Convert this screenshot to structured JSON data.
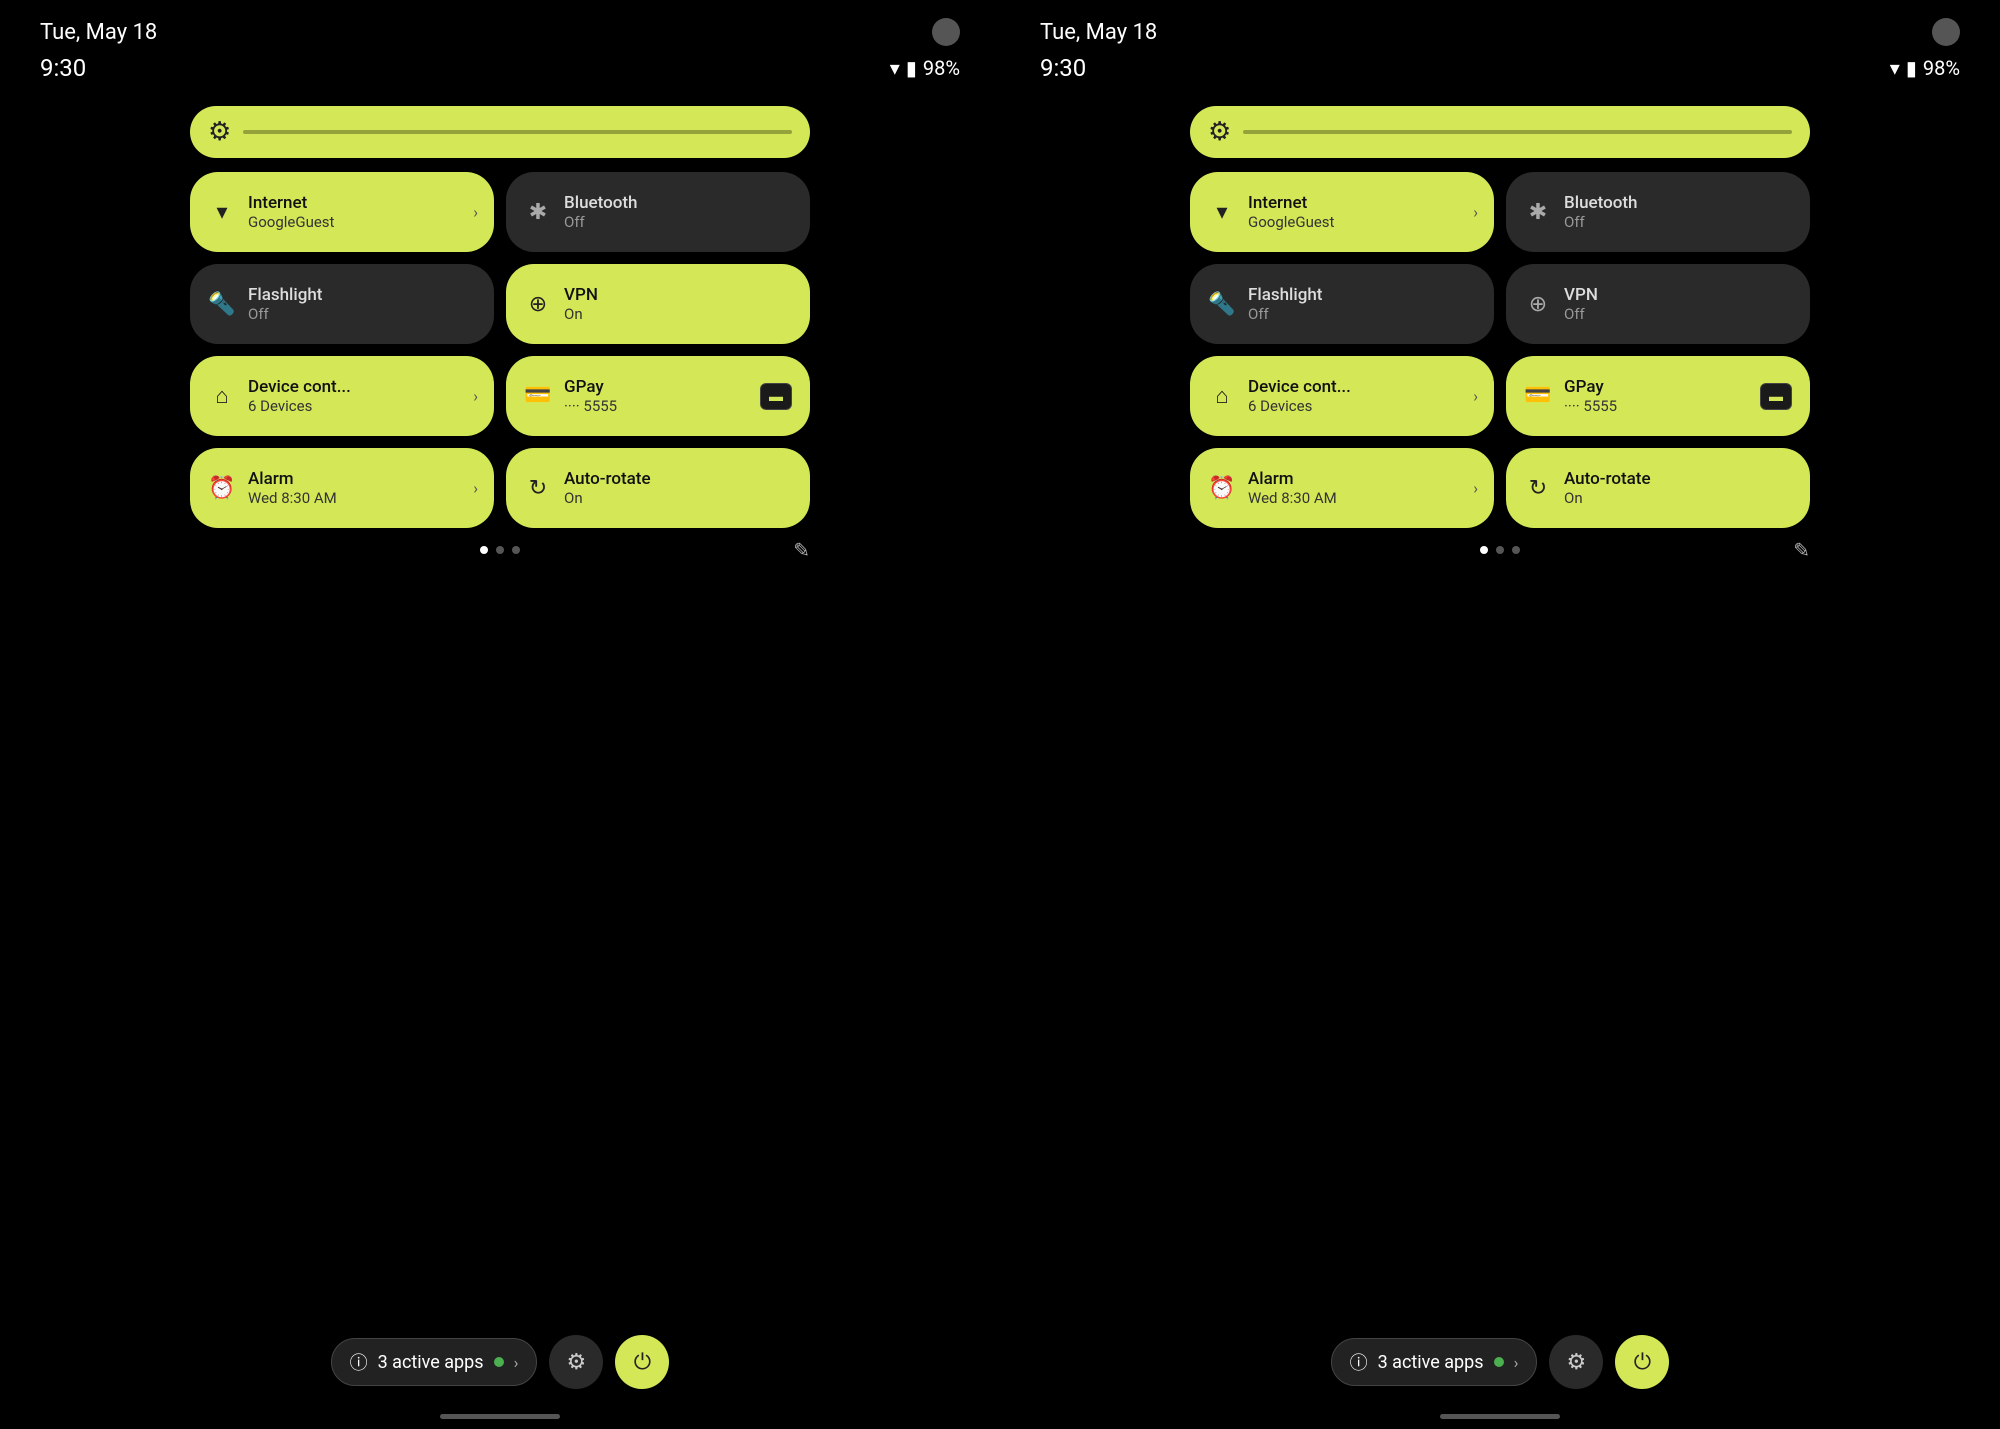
{
  "colors": {
    "active_tile": "#d4e857",
    "inactive_tile": "#2a2a2a",
    "bg": "#000",
    "active_dot": "#4caf50"
  },
  "panel1": {
    "date": "Tue, May 18",
    "time": "9:30",
    "battery": "98%",
    "tiles": [
      {
        "id": "internet",
        "label": "Internet",
        "sublabel": "GoogleGuest",
        "active": true,
        "has_arrow": true
      },
      {
        "id": "bluetooth",
        "label": "Bluetooth",
        "sublabel": "Off",
        "active": false,
        "has_arrow": false
      },
      {
        "id": "flashlight",
        "label": "Flashlight",
        "sublabel": "Off",
        "active": false,
        "has_arrow": false
      },
      {
        "id": "vpn",
        "label": "VPN",
        "sublabel": "On",
        "active": true,
        "has_arrow": false
      },
      {
        "id": "device",
        "label": "Device cont...",
        "sublabel": "6 Devices",
        "active": true,
        "has_arrow": true
      },
      {
        "id": "gpay",
        "label": "GPay",
        "sublabel": "···· 5555",
        "active": true,
        "has_arrow": false
      },
      {
        "id": "alarm",
        "label": "Alarm",
        "sublabel": "Wed 8:30 AM",
        "active": true,
        "has_arrow": true
      },
      {
        "id": "autorotate",
        "label": "Auto-rotate",
        "sublabel": "On",
        "active": true,
        "has_arrow": false
      }
    ],
    "active_apps_label": "3 active apps",
    "dots": [
      true,
      false,
      false
    ]
  },
  "panel2": {
    "date": "Tue, May 18",
    "time": "9:30",
    "battery": "98%",
    "tiles": [
      {
        "id": "internet",
        "label": "Internet",
        "sublabel": "GoogleGuest",
        "active": true,
        "has_arrow": true
      },
      {
        "id": "bluetooth",
        "label": "Bluetooth",
        "sublabel": "Off",
        "active": false,
        "has_arrow": false
      },
      {
        "id": "flashlight",
        "label": "Flashlight",
        "sublabel": "Off",
        "active": false,
        "has_arrow": false
      },
      {
        "id": "vpn",
        "label": "VPN",
        "sublabel": "Off",
        "active": false,
        "has_arrow": false
      },
      {
        "id": "device",
        "label": "Device cont...",
        "sublabel": "6 Devices",
        "active": true,
        "has_arrow": true
      },
      {
        "id": "gpay",
        "label": "GPay",
        "sublabel": "···· 5555",
        "active": true,
        "has_arrow": false
      },
      {
        "id": "alarm",
        "label": "Alarm",
        "sublabel": "Wed 8:30 AM",
        "active": true,
        "has_arrow": true
      },
      {
        "id": "autorotate",
        "label": "Auto-rotate",
        "sublabel": "On",
        "active": true,
        "has_arrow": false
      }
    ],
    "active_apps_label": "3 active apps",
    "dots": [
      true,
      false,
      false
    ]
  },
  "icons": {
    "internet": "▼",
    "bluetooth": "✱",
    "flashlight": "🔦",
    "vpn": "⊕",
    "device": "⌂",
    "gpay": "💳",
    "alarm": "⏰",
    "autorotate": "↻",
    "settings": "⚙",
    "power": "⏻",
    "info": "ⓘ",
    "edit": "✎"
  }
}
